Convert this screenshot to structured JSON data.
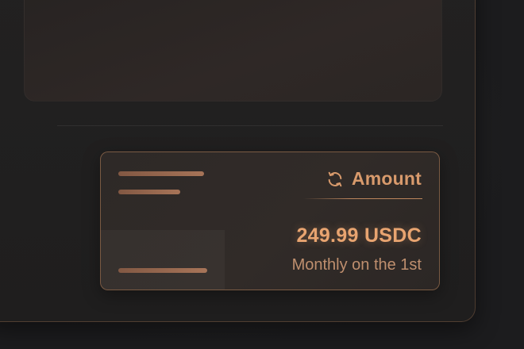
{
  "amount_card": {
    "title": "Amount",
    "title_icon": "refresh-icon",
    "value": "249.99 USDC",
    "schedule": "Monthly on the 1st"
  },
  "colors": {
    "accent": "#d89a6c",
    "value": "#e8a470",
    "muted": "#bf8f6e",
    "background": "#1e1e20"
  }
}
